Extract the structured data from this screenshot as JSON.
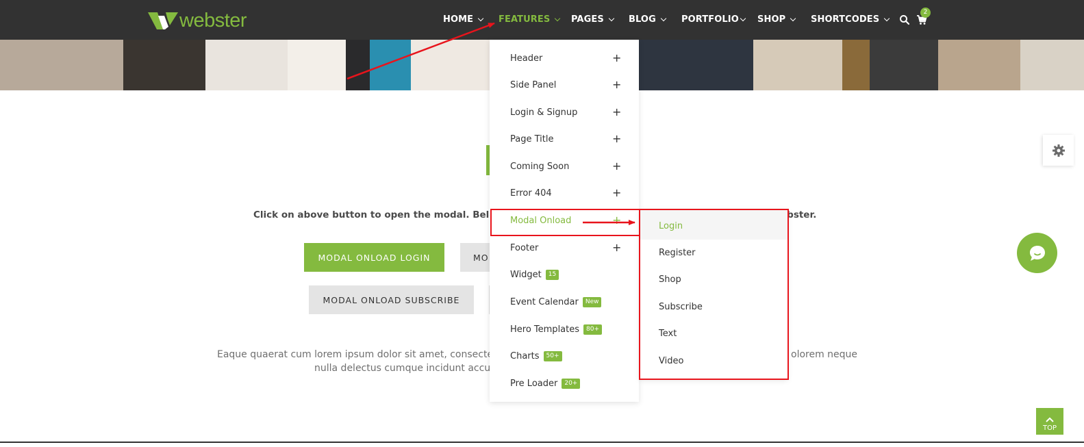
{
  "brand": {
    "logo_text": "webster",
    "accent": "#84ba3f"
  },
  "nav": {
    "items": [
      {
        "label": "HOME",
        "has_caret": true,
        "active": false
      },
      {
        "label": "FEATURES",
        "has_caret": true,
        "active": true
      },
      {
        "label": "PAGES",
        "has_caret": true,
        "active": false
      },
      {
        "label": "BLOG",
        "has_caret": true,
        "active": false
      },
      {
        "label": "PORTFOLIO",
        "has_caret": true,
        "active": false
      },
      {
        "label": "SHOP",
        "has_caret": true,
        "active": false
      },
      {
        "label": "SHORTCODES",
        "has_caret": true,
        "active": false
      }
    ],
    "search_icon": "search-icon",
    "cart_icon": "cart-icon",
    "cart_count": "2"
  },
  "features_menu": {
    "items": [
      {
        "label": "Header",
        "expand": "+"
      },
      {
        "label": "Side Panel",
        "expand": "+"
      },
      {
        "label": "Login & Signup",
        "expand": "+"
      },
      {
        "label": "Page Title",
        "expand": "+"
      },
      {
        "label": "Coming Soon",
        "expand": "+"
      },
      {
        "label": "Error 404",
        "expand": "+"
      },
      {
        "label": "Modal Onload",
        "expand": "+",
        "active": true
      },
      {
        "label": "Footer",
        "expand": "+"
      },
      {
        "label": "Widget",
        "badge": "15"
      },
      {
        "label": "Event Calendar",
        "badge": "New"
      },
      {
        "label": "Hero Templates",
        "badge": "80+"
      },
      {
        "label": "Charts",
        "badge": "50+"
      },
      {
        "label": "Pre Loader",
        "badge": "20+"
      }
    ]
  },
  "modal_onload_submenu": {
    "items": [
      {
        "label": "Login",
        "active": true
      },
      {
        "label": "Register"
      },
      {
        "label": "Shop"
      },
      {
        "label": "Subscribe"
      },
      {
        "label": "Text"
      },
      {
        "label": "Video"
      }
    ]
  },
  "content": {
    "intro_start": "Click on above button to open the modal. Below o",
    "intro_end": "ebster.",
    "buttons": {
      "login": "MODAL ONLOAD LOGIN",
      "second_partial": "MO",
      "subscribe": "MODAL ONLOAD SUBSCRIBE"
    },
    "paragraph": {
      "line1_left": "Eaque quaerat cum lorem ipsum dolor sit amet, consecte",
      "line1_right": "olorem neque",
      "line2_left": "nulla delectus cumque incidunt accu"
    }
  },
  "floating": {
    "settings_icon": "gear-icon",
    "chat_icon": "chat-icon",
    "top_label": "TOP"
  },
  "annotation_color": "#e8141c"
}
